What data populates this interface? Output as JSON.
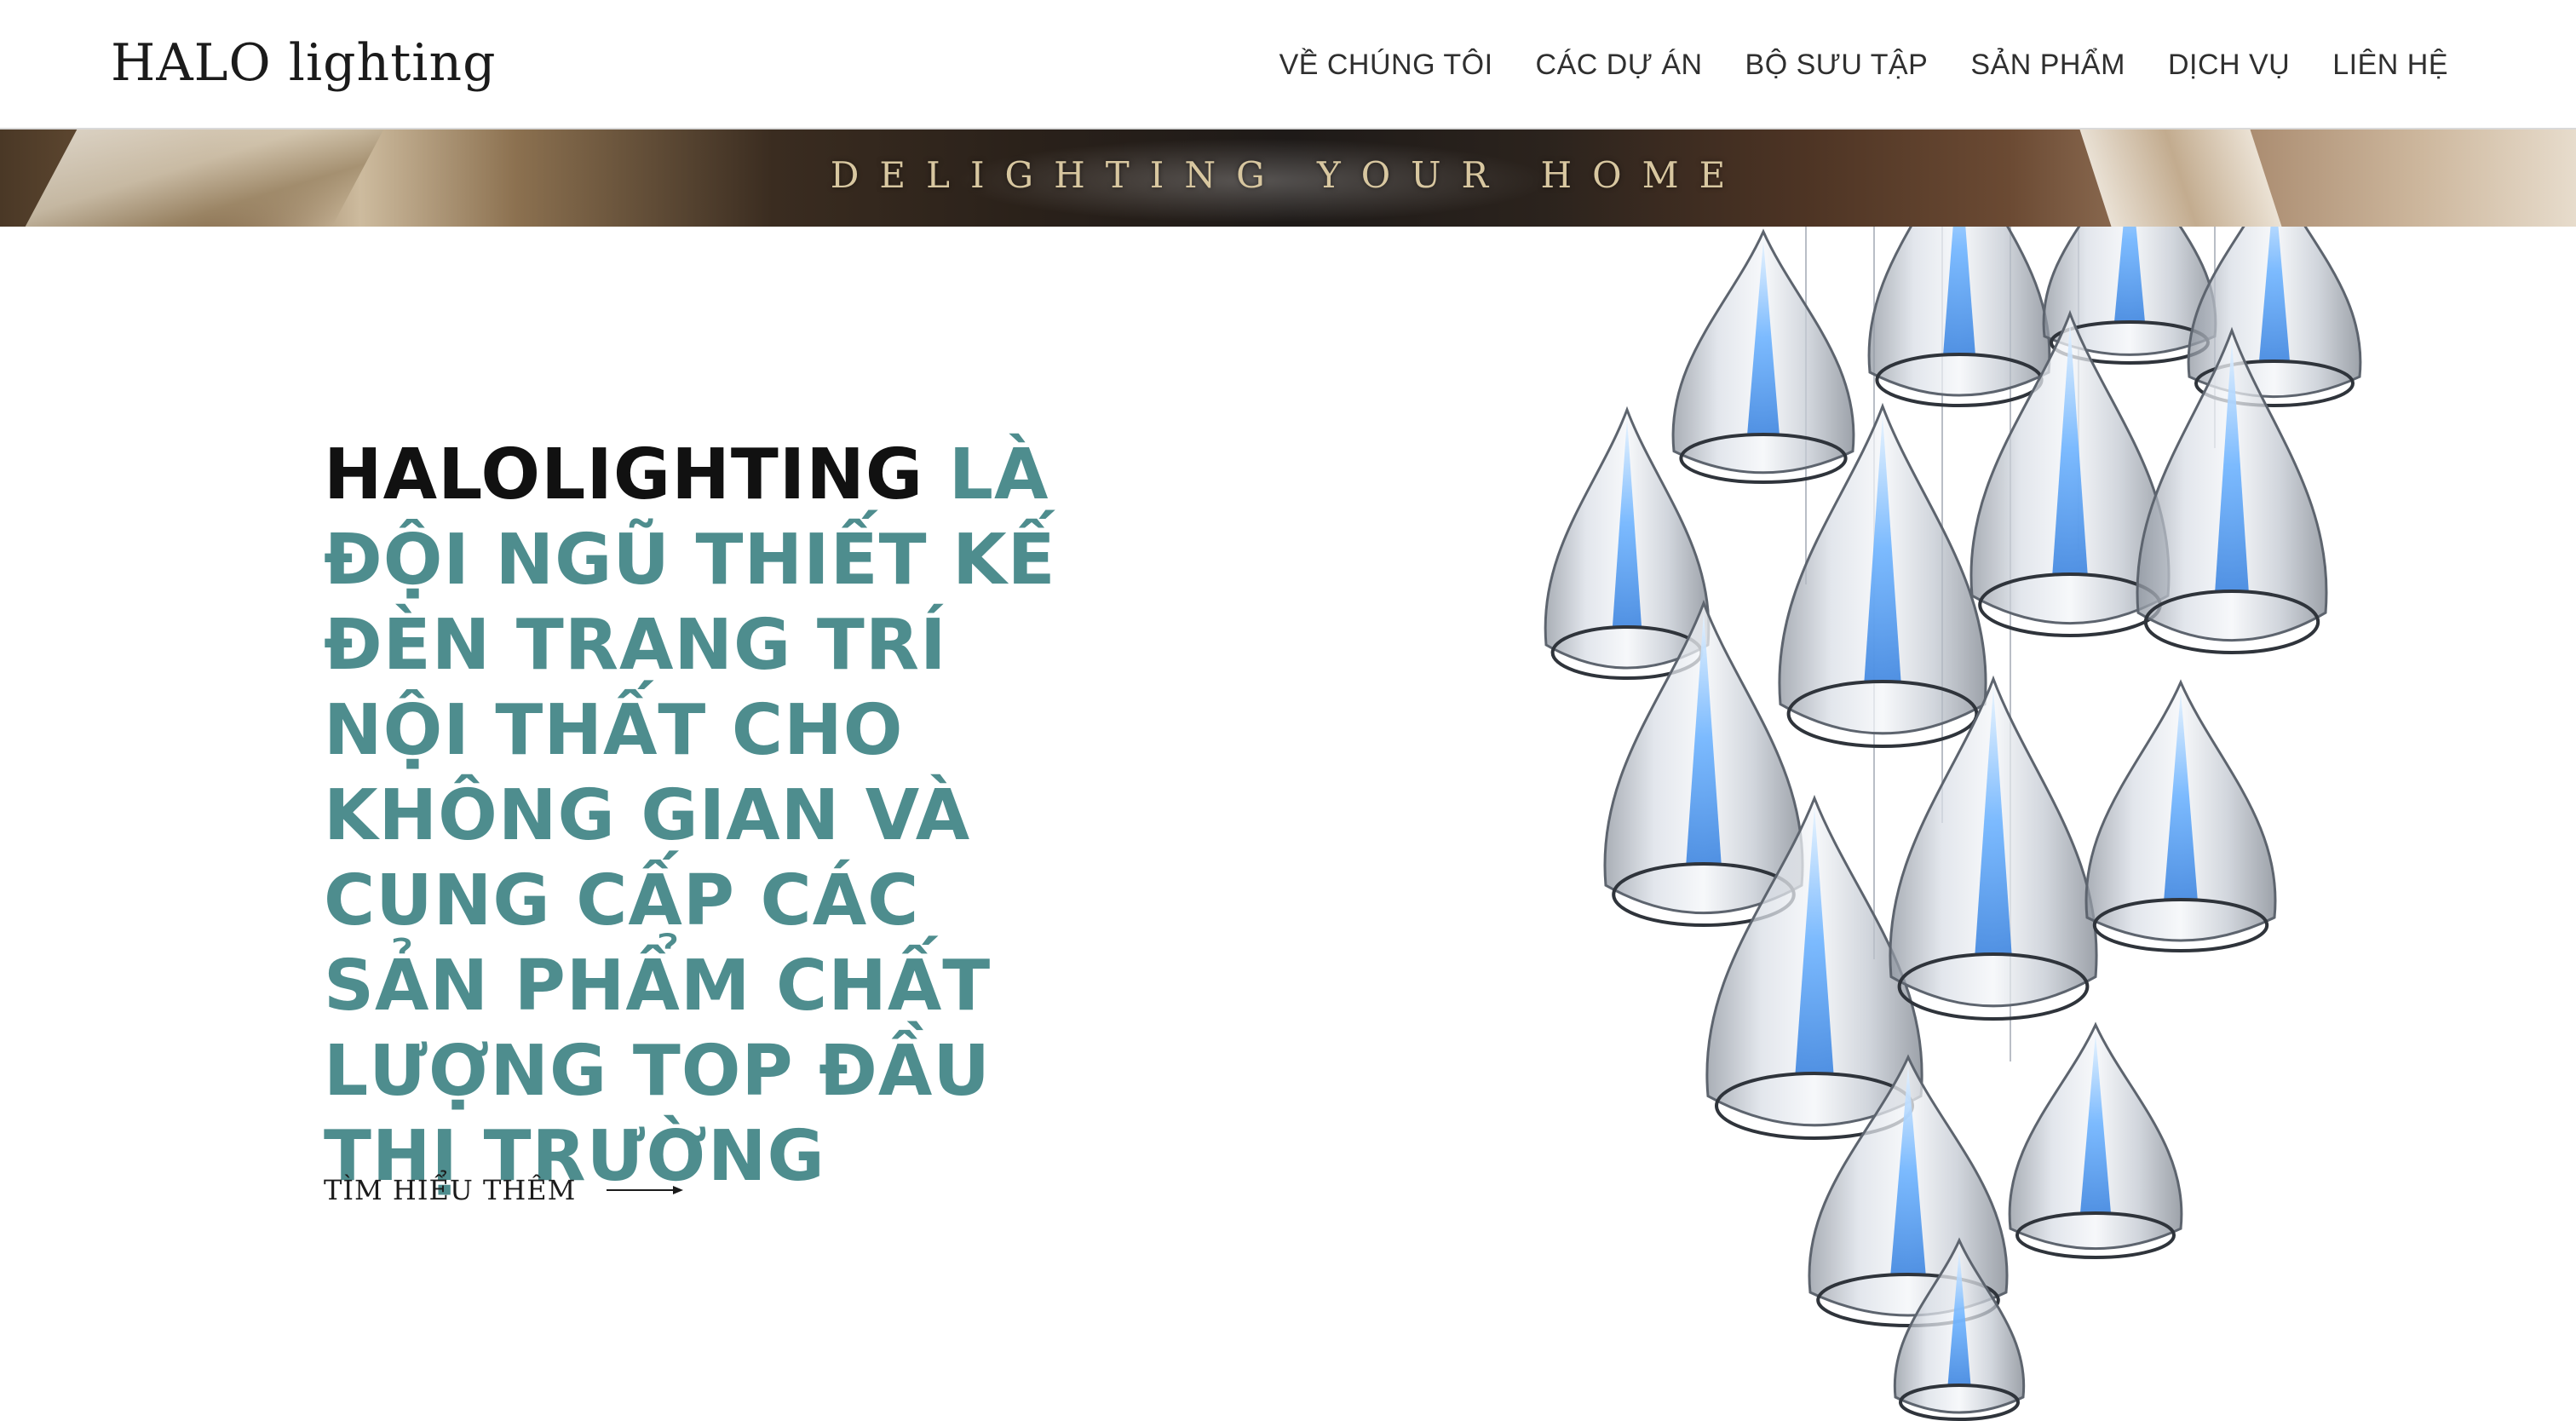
{
  "header": {
    "logo": "HALO lighting",
    "nav": [
      {
        "label": "VỀ CHÚNG TÔI"
      },
      {
        "label": "CÁC DỰ ÁN"
      },
      {
        "label": "BỘ SƯU TẬP"
      },
      {
        "label": "SẢN PHẨM"
      },
      {
        "label": "DỊCH VỤ"
      },
      {
        "label": "LIÊN HỆ"
      }
    ]
  },
  "banner": {
    "tagline": "DELIGHTING YOUR HOME"
  },
  "hero": {
    "brand": "HALOLIGHTING",
    "statement": "LÀ ĐỘI NGŨ THIẾT KẾ ĐÈN TRANG TRÍ NỘI THẤT CHO KHÔNG GIAN VÀ CUNG CẤP CÁC SẢN PHẨM CHẤT LƯỢNG TOP ĐẦU THỊ TRƯỜNG",
    "cta_label": "TÌM HIỂU THÊM"
  },
  "colors": {
    "accent": "#4e8d8e",
    "brand_text": "#111111",
    "crystal_glow": "#6fb4ff"
  },
  "icons": {
    "cta_arrow": "arrow-right-icon"
  }
}
